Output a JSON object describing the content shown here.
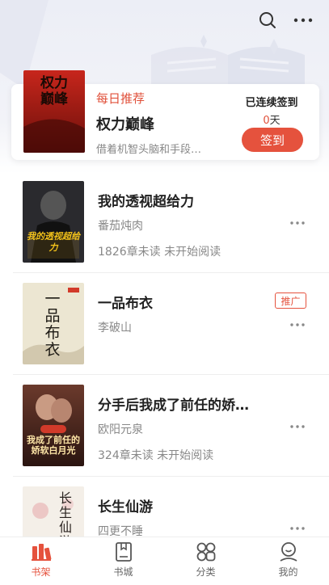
{
  "header": {
    "search_icon": "search-icon",
    "more_icon": "more-horizontal-icon"
  },
  "daily": {
    "tag": "每日推荐",
    "title": "权力巅峰",
    "desc": "借着机智头脑和手段…",
    "cover_text": "权力巅峰",
    "sign_label": "已连续签到",
    "sign_days": "0",
    "sign_unit": "天",
    "sign_button": "签到"
  },
  "books": [
    {
      "title": "我的透视超给力",
      "author": "番茄炖肉",
      "status": "1826章未读 未开始阅读",
      "promo": "",
      "cover_text": "我的透视超给力"
    },
    {
      "title": "一品布衣",
      "author": "李破山",
      "status": "",
      "promo": "推广",
      "cover_text": "一品布衣"
    },
    {
      "title": "分手后我成了前任的娇…",
      "author": "欧阳元泉",
      "status": "324章未读 未开始阅读",
      "promo": "",
      "cover_text": "我成了前任的娇软白月光"
    },
    {
      "title": "长生仙游",
      "author": "四更不睡",
      "status": "",
      "promo": "",
      "cover_text": "长生仙游"
    }
  ],
  "tabs": [
    {
      "label": "书架",
      "icon": "bookshelf-icon",
      "active": true
    },
    {
      "label": "书城",
      "icon": "book-store-icon",
      "active": false
    },
    {
      "label": "分类",
      "icon": "category-icon",
      "active": false
    },
    {
      "label": "我的",
      "icon": "profile-icon",
      "active": false
    }
  ],
  "colors": {
    "accent": "#e5523d",
    "text": "#222222",
    "muted": "#888888"
  }
}
